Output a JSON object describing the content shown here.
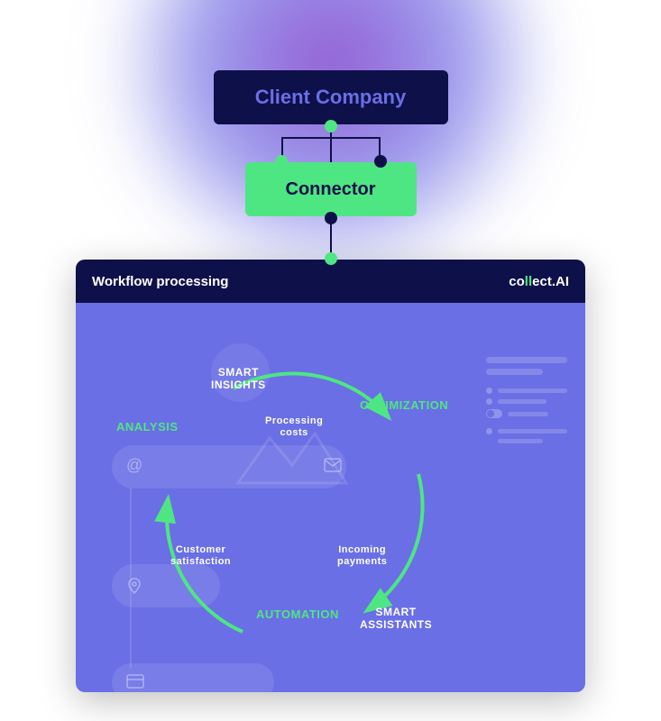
{
  "top": {
    "client_label": "Client Company",
    "connector_label": "Connector"
  },
  "panel": {
    "title": "Workflow processing",
    "brand_prefix": "co",
    "brand_accent": "ll",
    "brand_suffix": "ect.AI"
  },
  "cycle": {
    "smart_insights": "SMART\nINSIGHTS",
    "optimization": "OPTIMIZATION",
    "analysis": "ANALYSIS",
    "processing_costs": "Processing\ncosts",
    "customer_satisfaction": "Customer\nsatisfaction",
    "incoming_payments": "Incoming\npayments",
    "automation": "AUTOMATION",
    "smart_assistants": "SMART\nASSISTANTS"
  }
}
